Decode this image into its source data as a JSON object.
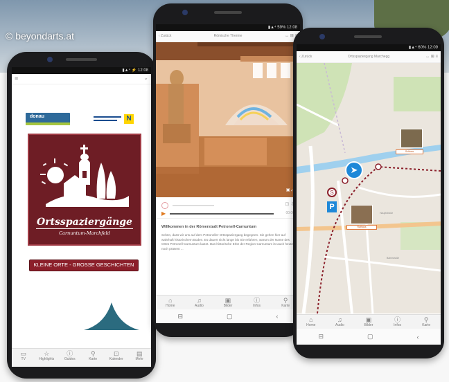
{
  "watermark": "© beyondarts.at",
  "phone_left": {
    "logo_left": "donau",
    "logo_right": "N",
    "crest_title": "Ortsspaziergänge",
    "crest_subtitle": "Carnuntum-Marchfeld",
    "cta_button": "KLEINE ORTE - GROSSE GESCHICHTEN",
    "tabs": [
      "TV",
      "Highlights",
      "Guides",
      "Karte",
      "Kalender",
      "Mehr"
    ]
  },
  "phone_middle": {
    "header_back": "‹ Zurück",
    "header_title": "Römische Therme",
    "section_heading": "Willkommen in der Römerstadt Petronell-Carnuntum",
    "paragraph": "Schön, dass wir uns auf dem Petroneller Ortsspaziergang begegnen. Sie gehen hier auf wahrhaft historischem Boden. Es dauert nicht lange bis Sie erfahren, warum der Name des Ortes Petronell-Carnuntum lautet. Das historische Erbe der Region Carnuntum ist auch heute noch präsent ...",
    "tabs": [
      "Home",
      "Audio",
      "Bilder",
      "Infos",
      "Karte"
    ]
  },
  "phone_right": {
    "header_back": "‹ Zurück",
    "header_title": "Ortsspaziergang Marchegg",
    "map_labels": [
      "Schloss",
      "Rathaus",
      "Hauptstraße",
      "Bahnstraße"
    ],
    "tabs": [
      "Home",
      "Audio",
      "Bilder",
      "Infos",
      "Karte"
    ]
  },
  "colors": {
    "crest": "#6e1d25",
    "accent_blue": "#1e88d8",
    "route": "#8b1f2a",
    "water": "#9fd0ee"
  }
}
